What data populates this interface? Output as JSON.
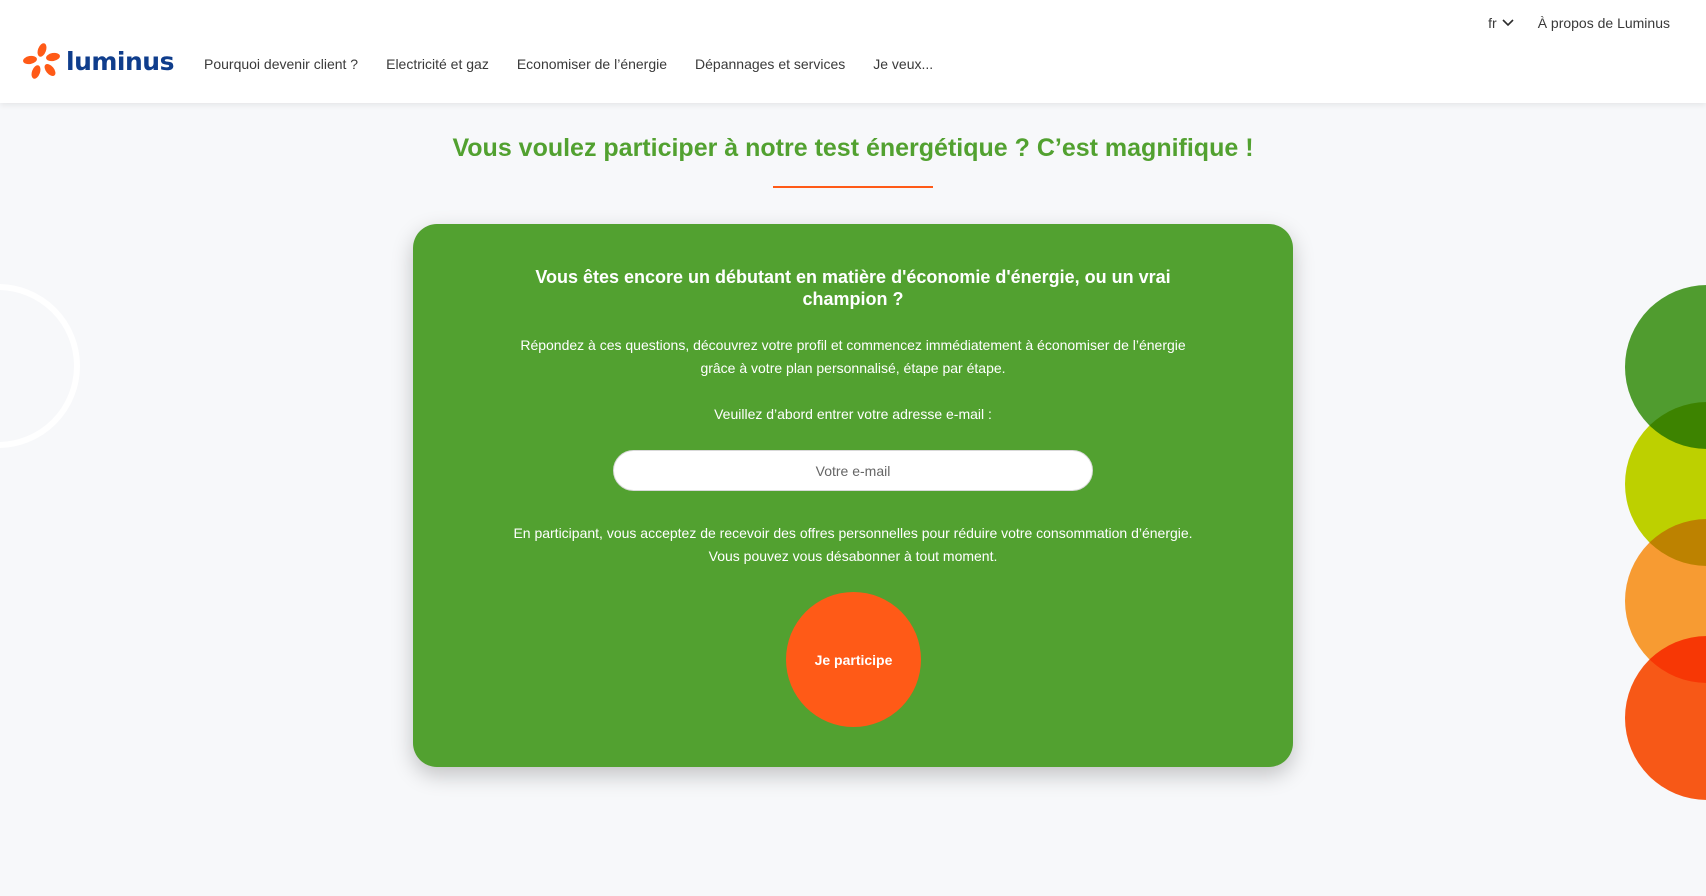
{
  "header": {
    "brand": "luminus",
    "nav": [
      "Pourquoi devenir client ?",
      "Electricité et gaz",
      "Economiser de l’énergie",
      "Dépannages et services",
      "Je veux..."
    ],
    "language": "fr",
    "about_link": "À propos de Luminus"
  },
  "main": {
    "title": "Vous voulez participer à notre test énergétique ? C’est magnifique !",
    "card": {
      "title": "Vous êtes encore un débutant en matière d'économie d'énergie, ou un vrai champion ?",
      "intro": "Répondez à ces questions, découvrez votre profil et commencez immédiatement à économiser de l’énergie grâce à votre plan personnalisé, étape par étape.",
      "prompt": "Veuillez d’abord entrer votre adresse e-mail :",
      "email_placeholder": "Votre e-mail",
      "legal": "En participant, vous acceptez de recevoir des offres personnelles pour réduire votre consommation d’énergie. Vous pouvez vous désabonner à tout moment.",
      "cta_label": "Je participe"
    }
  },
  "colors": {
    "brand_green": "#52a130",
    "brand_orange": "#ff5a17",
    "lime": "#c3d600",
    "amber": "#ff9f33",
    "logo_blue": "#0f3d8c"
  },
  "icons": [
    "luminus-logo-icon",
    "chevron-down-icon"
  ]
}
